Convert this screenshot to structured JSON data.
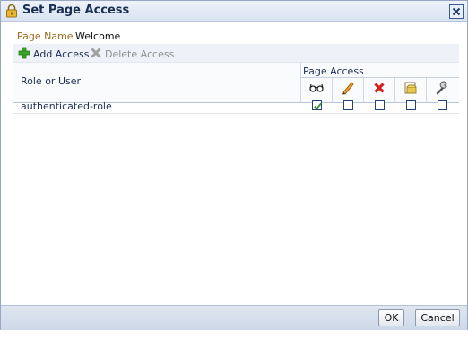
{
  "dialog": {
    "title": "Set Page Access",
    "icons": {
      "title": "lock-icon",
      "close": "close-icon"
    }
  },
  "page_name": {
    "label": "Page Name",
    "value": "Welcome"
  },
  "toolbar": {
    "add_label": "Add Access",
    "delete_label": "Delete Access",
    "add_icon": "green-plus-icon",
    "delete_icon": "grey-x-icon",
    "delete_enabled": false
  },
  "table": {
    "role_header": "Role or User",
    "access_header": "Page Access",
    "permission_icons": [
      "view-glasses-icon",
      "edit-pencil-icon",
      "delete-x-icon",
      "customize-page-icon",
      "manage-wrench-icon"
    ],
    "rows": [
      {
        "role": "authenticated-role",
        "permissions": [
          true,
          false,
          false,
          false,
          false
        ]
      }
    ]
  },
  "footer": {
    "ok_label": "OK",
    "cancel_label": "Cancel"
  },
  "colors": {
    "title_text": "#1b2f52",
    "label_brown": "#9a6a1e",
    "checkbox_border": "#25417a",
    "check_green": "#3a8a2a"
  }
}
